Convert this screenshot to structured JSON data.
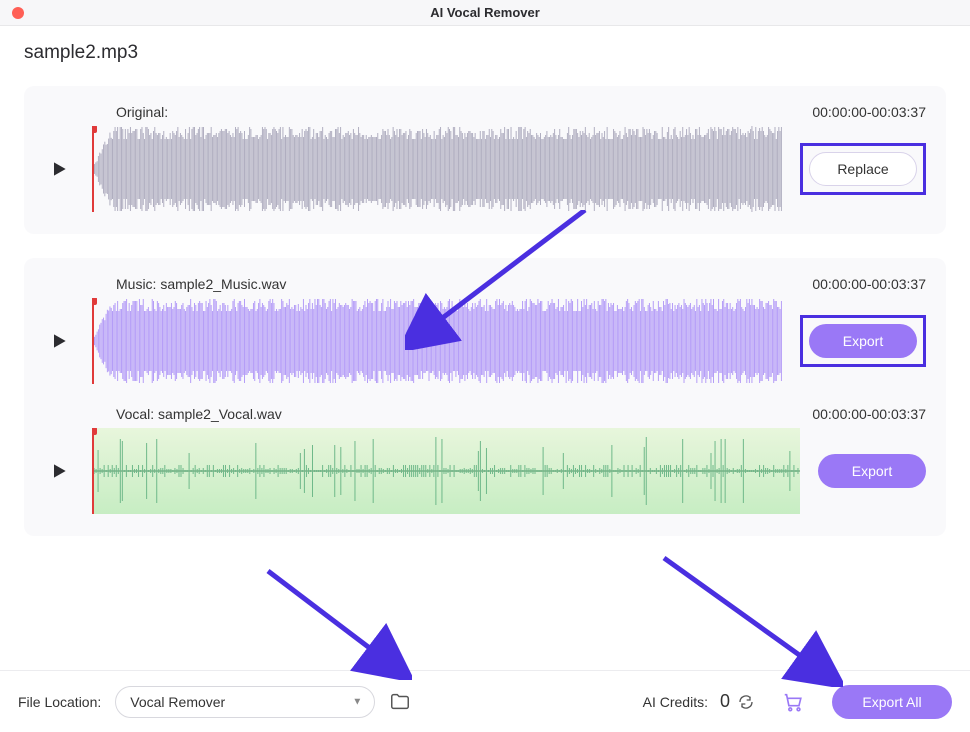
{
  "window": {
    "title": "AI Vocal Remover",
    "filename": "sample2.mp3"
  },
  "tracks": [
    {
      "label": "Original:",
      "time": "00:00:00-00:03:37",
      "button_label": "Replace",
      "button_style": "outline",
      "highlighted": true,
      "wave_color": "#b0aec0",
      "wave_bg": "transparent",
      "wave_kind": "dense"
    },
    {
      "label": "Music: sample2_Music.wav",
      "time": "00:00:00-00:03:37",
      "button_label": "Export",
      "button_style": "purple",
      "highlighted": true,
      "wave_color": "#b49cf7",
      "wave_bg": "transparent",
      "wave_kind": "dense"
    },
    {
      "label": "Vocal: sample2_Vocal.wav",
      "time": "00:00:00-00:03:37",
      "button_label": "Export",
      "button_style": "purple",
      "highlighted": false,
      "wave_color": "#6fb98a",
      "wave_bg": "linear-gradient(#e8f6dc,#c7edc3)",
      "wave_kind": "sparse"
    }
  ],
  "footer": {
    "location_label": "File Location:",
    "dropdown_value": "Vocal Remover",
    "credits_label": "AI Credits:",
    "credits_value": "0",
    "export_all_label": "Export All"
  }
}
